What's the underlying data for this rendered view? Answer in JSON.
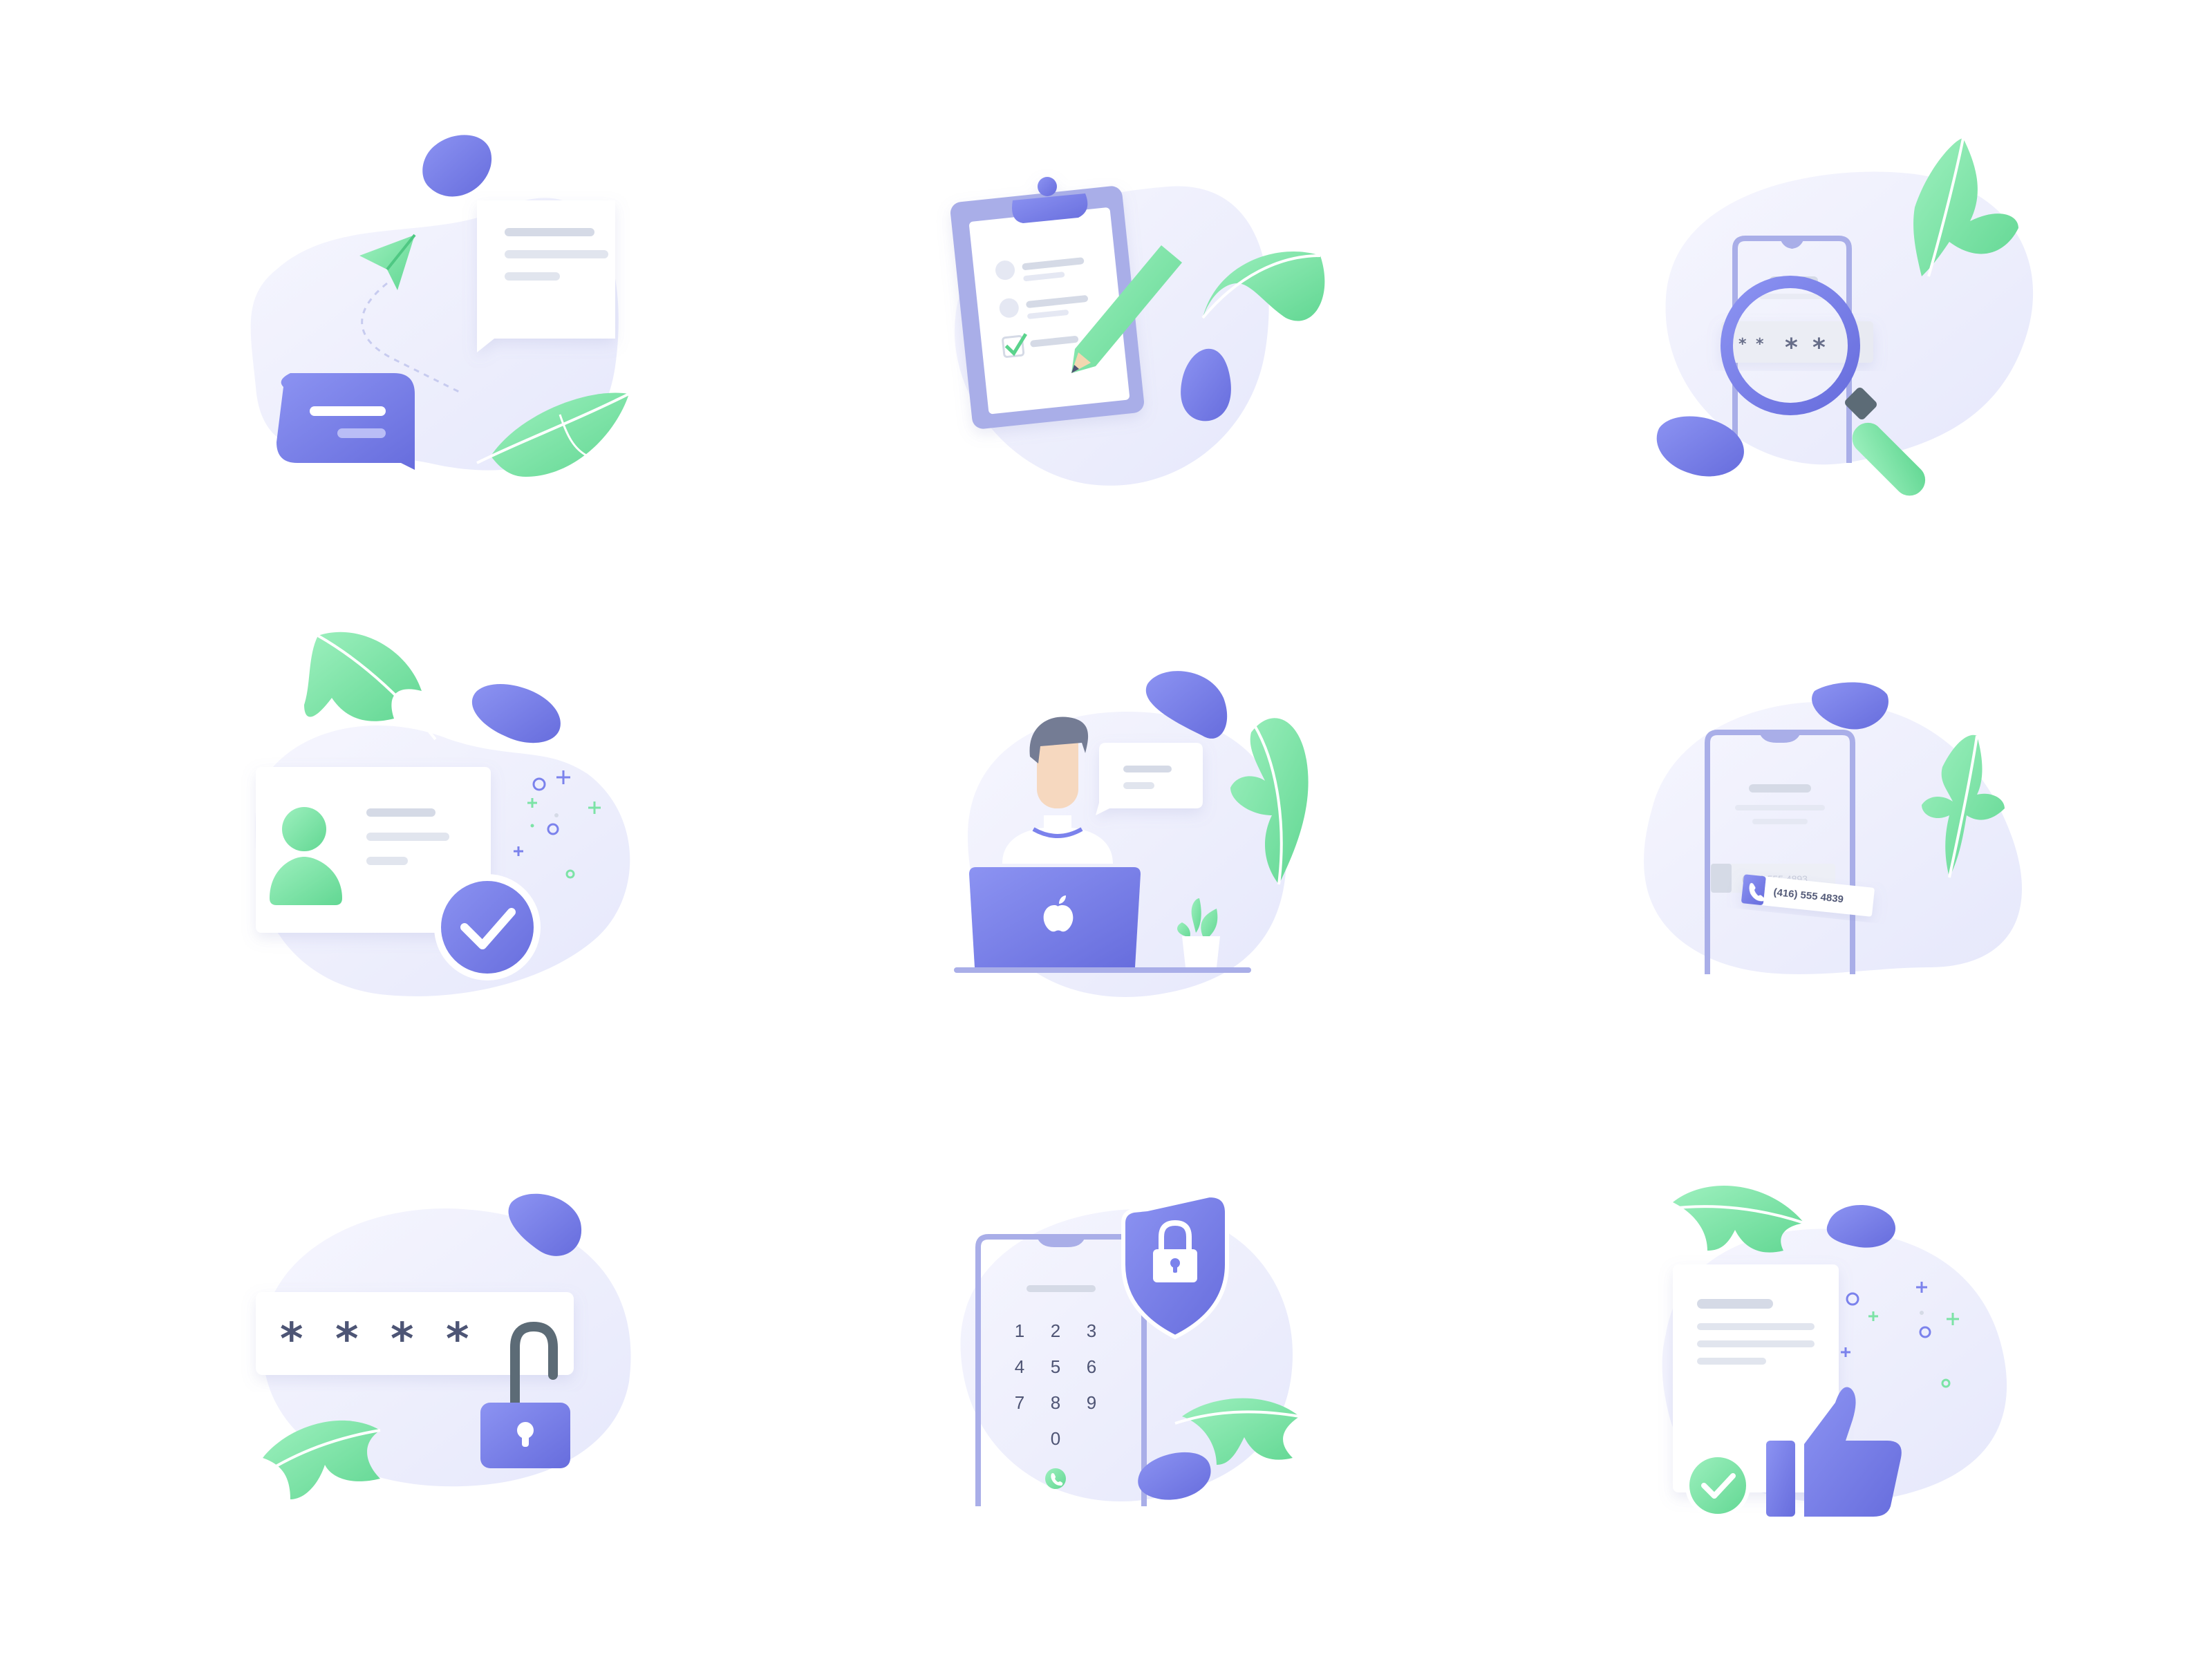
{
  "illustrations": [
    {
      "name": "messaging"
    },
    {
      "name": "checklist"
    },
    {
      "name": "password-search"
    },
    {
      "name": "profile-verified"
    },
    {
      "name": "person-laptop"
    },
    {
      "name": "phone-number",
      "phone_text_1": "(416) 555 4893",
      "phone_text_2": "(416) 555 4839"
    },
    {
      "name": "password-unlock",
      "asterisks": [
        "*",
        "*",
        "*",
        "*"
      ]
    },
    {
      "name": "phone-security",
      "keypad": [
        "1",
        "2",
        "3",
        "4",
        "5",
        "6",
        "7",
        "8",
        "9",
        "0"
      ]
    },
    {
      "name": "document-approved"
    }
  ],
  "search": {
    "asterisks": [
      "*",
      "*",
      "*",
      "*"
    ]
  },
  "colors": {
    "purple": "#7B82EC",
    "purple_dark": "#6A70E0",
    "green": "#7CE3A6",
    "blob": "#EEEFFC",
    "gray_line": "#D5DAE6",
    "frame": "#A9AEE8",
    "text_dark": "#4E5474"
  }
}
